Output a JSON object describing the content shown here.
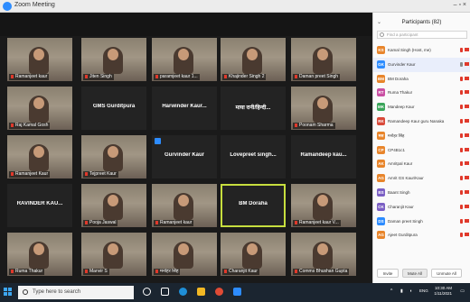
{
  "window": {
    "title": "Zoom Meeting"
  },
  "gallery": {
    "row1": [
      {
        "label": "Ramanjeet kaur",
        "kind": "cam"
      },
      {
        "label": "Jiten Singh",
        "kind": "cam"
      },
      {
        "label": "paramjeet kaur 1...",
        "kind": "cam"
      },
      {
        "label": "Khajinder Singh 2",
        "kind": "cam"
      },
      {
        "label": "Daman preet Singh",
        "kind": "cam"
      }
    ],
    "row2": [
      {
        "label": "Raj Kamal Gosh",
        "kind": "cam"
      },
      {
        "bigname": "GMS Gurditpura",
        "kind": "name"
      },
      {
        "bigname": "Harwinder Kaur...",
        "kind": "name"
      },
      {
        "bigname": "माया रानी/हिन्दी...",
        "kind": "name"
      },
      {
        "label": "Poonam Sharma",
        "kind": "cam"
      }
    ],
    "row3": [
      {
        "label": "Ramanjeet Kaur",
        "kind": "cam"
      },
      {
        "label": "Tejpreet Kaur",
        "kind": "cam"
      },
      {
        "bigname": "Gurvinder Kaur",
        "kind": "name"
      },
      {
        "bigname": "Lovepreet singh...",
        "kind": "name"
      },
      {
        "bigname": "Ramandeep kau...",
        "kind": "name"
      }
    ],
    "row4": [
      {
        "bigname": "RAVINDER KAU...",
        "kind": "name"
      },
      {
        "label": "Pooja Jaswal",
        "kind": "cam"
      },
      {
        "label": "Ramanjeet kaur",
        "kind": "cam"
      },
      {
        "bigname": "BM Doraha",
        "kind": "name",
        "active": true
      },
      {
        "label": "Ramanjeet kaur V...",
        "kind": "cam"
      }
    ],
    "row5": [
      {
        "label": "Ruma Thakur",
        "kind": "cam"
      },
      {
        "label": "Manvir S",
        "kind": "cam"
      },
      {
        "label": "मनोहर सिंह",
        "kind": "cam"
      },
      {
        "label": "Charanjit Kaur",
        "kind": "cam"
      },
      {
        "label": "Comms Bhushan Gupta",
        "kind": "cam"
      }
    ]
  },
  "panel": {
    "title": "Participants (82)",
    "collapse_glyph": "⌄",
    "window_controls": "–  ▫  ×",
    "search_placeholder": "Find a participant",
    "participants": [
      {
        "initials": "KS",
        "name": "Kamal Singh (Host, me)",
        "color": "#e8852b"
      },
      {
        "initials": "GK",
        "name": "Gurvinder Kaur",
        "color": "#2d8cff",
        "highlight": true
      },
      {
        "initials": "BM",
        "name": "BM Doraha",
        "color": "#e8852b"
      },
      {
        "initials": "RT",
        "name": "Ruma Thakur",
        "color": "#c94fa3"
      },
      {
        "initials": "MK",
        "name": "Mandeep Kaur",
        "color": "#3aa55a"
      },
      {
        "initials": "RK",
        "name": "Ramandeep Kaur guru Nanaka",
        "color": "#d94a3a"
      },
      {
        "initials": "मस",
        "name": "मनोहर सिंह",
        "color": "#e8852b"
      },
      {
        "initials": "CP",
        "name": "CP4B1c1",
        "color": "#e8852b"
      },
      {
        "initials": "AK",
        "name": "Amritpal Kaur",
        "color": "#e8852b"
      },
      {
        "initials": "AG",
        "name": "Amrit GS Kaur/Kaur",
        "color": "#e8852b"
      },
      {
        "initials": "BS",
        "name": "Baant Singh",
        "color": "#7b5fc4"
      },
      {
        "initials": "CK",
        "name": "Charanjit Kaur",
        "color": "#7b5fc4"
      },
      {
        "initials": "DS",
        "name": "Daman preet Singh",
        "color": "#2d8cff"
      },
      {
        "initials": "AG",
        "name": "Ajeet Gurditpura",
        "color": "#e8852b"
      }
    ],
    "footer": {
      "invite": "Invite",
      "mute_all": "Mute All",
      "unmute_all": "Unmute All"
    }
  },
  "taskbar": {
    "search_placeholder": "Type here to search",
    "clock_time": "10:30 AM",
    "clock_date": "1/11/2021",
    "language": "ENG"
  }
}
